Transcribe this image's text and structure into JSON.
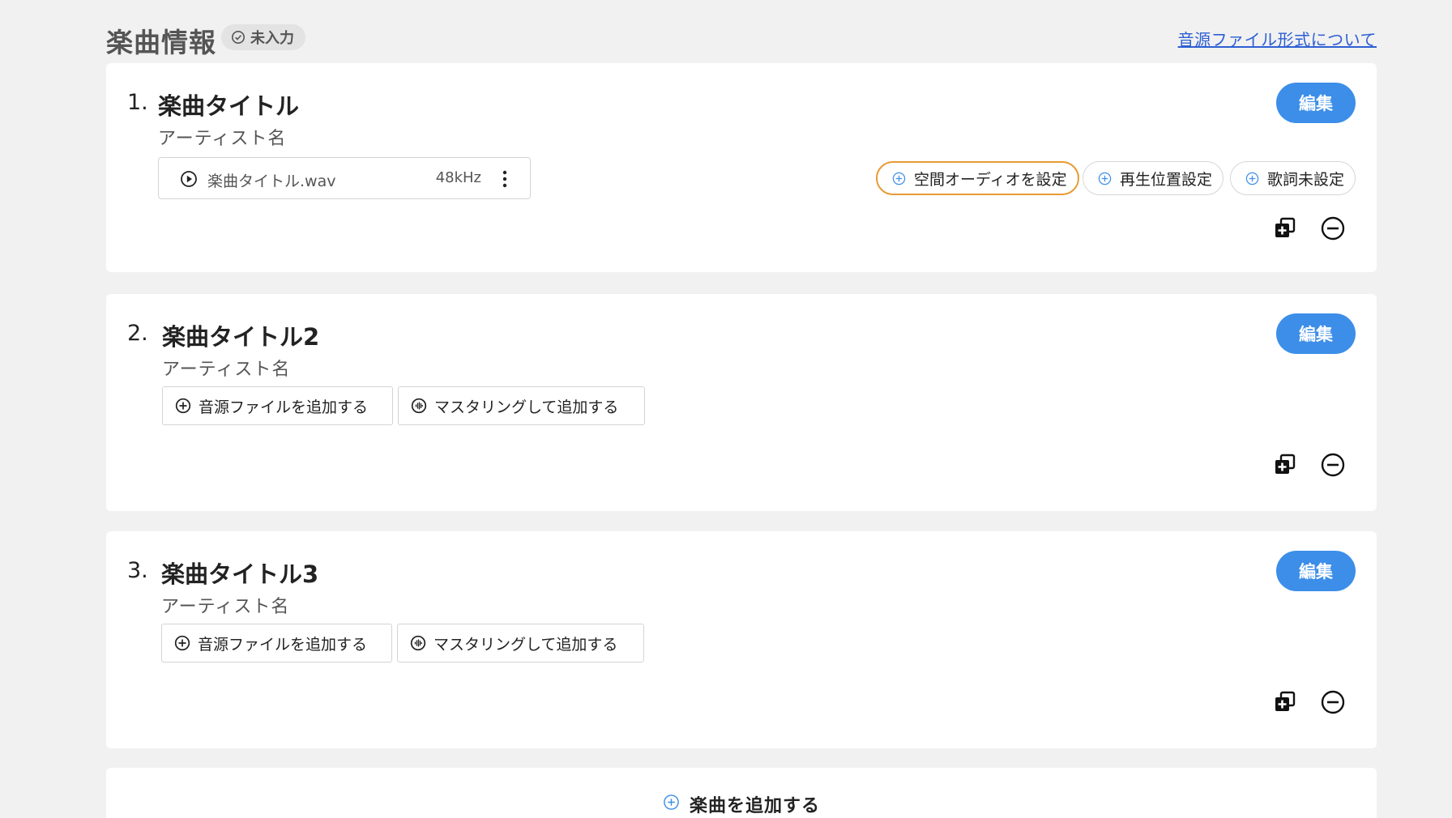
{
  "section": {
    "title": "楽曲情報",
    "status_badge": "未入力",
    "format_link": "音源ファイル形式について"
  },
  "tracks": [
    {
      "number": "1.",
      "title": "楽曲タイトル",
      "artist": "アーティスト名",
      "edit_label": "編集",
      "file": {
        "name": "楽曲タイトル.wav",
        "sample_rate": "48kHz"
      },
      "chips": [
        {
          "label": "空間オーディオを設定",
          "active": true
        },
        {
          "label": "再生位置設定",
          "active": false
        },
        {
          "label": "歌詞未設定",
          "active": false
        }
      ]
    },
    {
      "number": "2.",
      "title": "楽曲タイトル2",
      "artist": "アーティスト名",
      "edit_label": "編集",
      "add_file_label": "音源ファイルを追加する",
      "mastering_label": "マスタリングして追加する"
    },
    {
      "number": "3.",
      "title": "楽曲タイトル3",
      "artist": "アーティスト名",
      "edit_label": "編集",
      "add_file_label": "音源ファイルを追加する",
      "mastering_label": "マスタリングして追加する"
    }
  ],
  "add_track": {
    "label": "楽曲を追加する"
  },
  "colors": {
    "accent_blue": "#3c8ee8",
    "link_blue": "#2d5fd3",
    "active_chip_border": "#e89a34",
    "background": "#f1f1f1"
  },
  "icons": {
    "status": "check-circle-icon",
    "play": "play-circle-icon",
    "menu": "more-vertical-icon",
    "chip": "plus-circle-icon",
    "add_file": "plus-circle-icon",
    "mastering": "waveform-circle-icon",
    "duplicate": "duplicate-icon",
    "remove": "minus-circle-icon"
  }
}
